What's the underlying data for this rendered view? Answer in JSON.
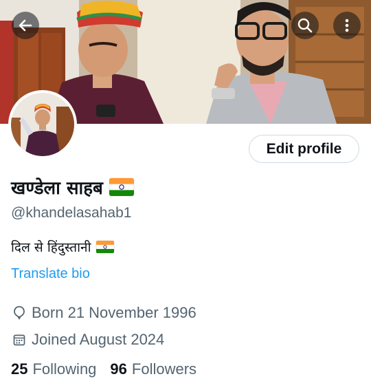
{
  "header": {
    "back_icon": "arrow-left-icon",
    "search_icon": "search-icon",
    "more_icon": "more-vertical-icon"
  },
  "profile": {
    "edit_label": "Edit profile",
    "display_name": "खण्डेला साहब",
    "handle": "@khandelasahab1",
    "bio": "दिल से हिंदुस्तानी",
    "translate_label": "Translate bio",
    "born": "Born 21 November 1996",
    "joined": "Joined August 2024",
    "following_count": "25",
    "following_label": "Following",
    "followers_count": "96",
    "followers_label": "Followers"
  },
  "colors": {
    "link": "#1d9bf0",
    "secondary_text": "#536471",
    "primary_text": "#0f1419",
    "flag_saffron": "#ff9933",
    "flag_green": "#138808",
    "flag_chakra": "#000080"
  }
}
